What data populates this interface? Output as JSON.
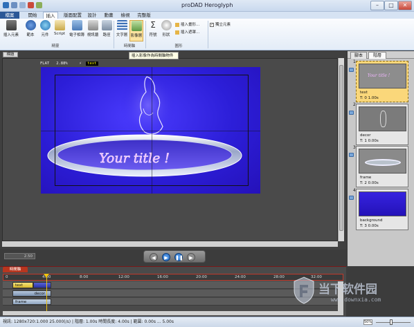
{
  "app": {
    "title": "proDAD Heroglyph"
  },
  "ribbon_tabs": [
    "檔案",
    "開始",
    "插入",
    "版面配置",
    "設計",
    "動畫",
    "檢視",
    "完整版"
  ],
  "ribbon": {
    "buttons": {
      "insert_element": "插入元素",
      "library": "範本",
      "element": "元件",
      "script": "Script",
      "album": "電子相簿",
      "video": "視訊牆",
      "path": "路徑",
      "text_layer": "文字層",
      "image_layer": "影像層",
      "symbol": "符號",
      "shape": "形狀",
      "insert_drawing": "插入畫形...",
      "insert_mask": "插入遮罩...",
      "standalone": "獨立元素"
    },
    "groups": {
      "effects": "精靈",
      "timeline": "時間軸",
      "graphics": "圖形"
    }
  },
  "tooltip": "插入影像作為時間軸物件",
  "stage": {
    "label": "標題",
    "info_mode": "FLAT",
    "info_zoom": "2.88%",
    "info_tag": "text",
    "zoom_value": "2.50",
    "title_text": "Your title !"
  },
  "layers_panel": {
    "tabs": [
      "腳本",
      "階層"
    ],
    "layers": [
      {
        "num": "1.",
        "name": "text",
        "time": "T: 0  1.00s",
        "selected": true
      },
      {
        "num": "2.",
        "name": "decor",
        "time": "T: 1  0.00s",
        "selected": false
      },
      {
        "num": "3.",
        "name": "frame",
        "time": "T: 2  0.00s",
        "selected": false
      },
      {
        "num": "4.",
        "name": "background",
        "time": "T: 3  0.00s",
        "selected": false
      }
    ]
  },
  "timeline": {
    "tab_label": "時間軸",
    "ticks": [
      "4:00",
      "8:00",
      "12:00",
      "16:00",
      "20:00",
      "24:00",
      "28:00",
      "32:00"
    ],
    "start_tick": "0",
    "tracks": [
      {
        "label": "text"
      },
      {
        "label": "decor"
      },
      {
        "label": "frame"
      }
    ]
  },
  "watermark": {
    "line1": "当下软件园",
    "line2": "www.downxia.com"
  },
  "statusbar": {
    "text": "視訊: 1280x720:1.000  25.000(/s)  | 階層: 1.00s  時間長度: 4.00s  | 範圍: 0.00s ... 5.00s",
    "zoom": "50%"
  }
}
